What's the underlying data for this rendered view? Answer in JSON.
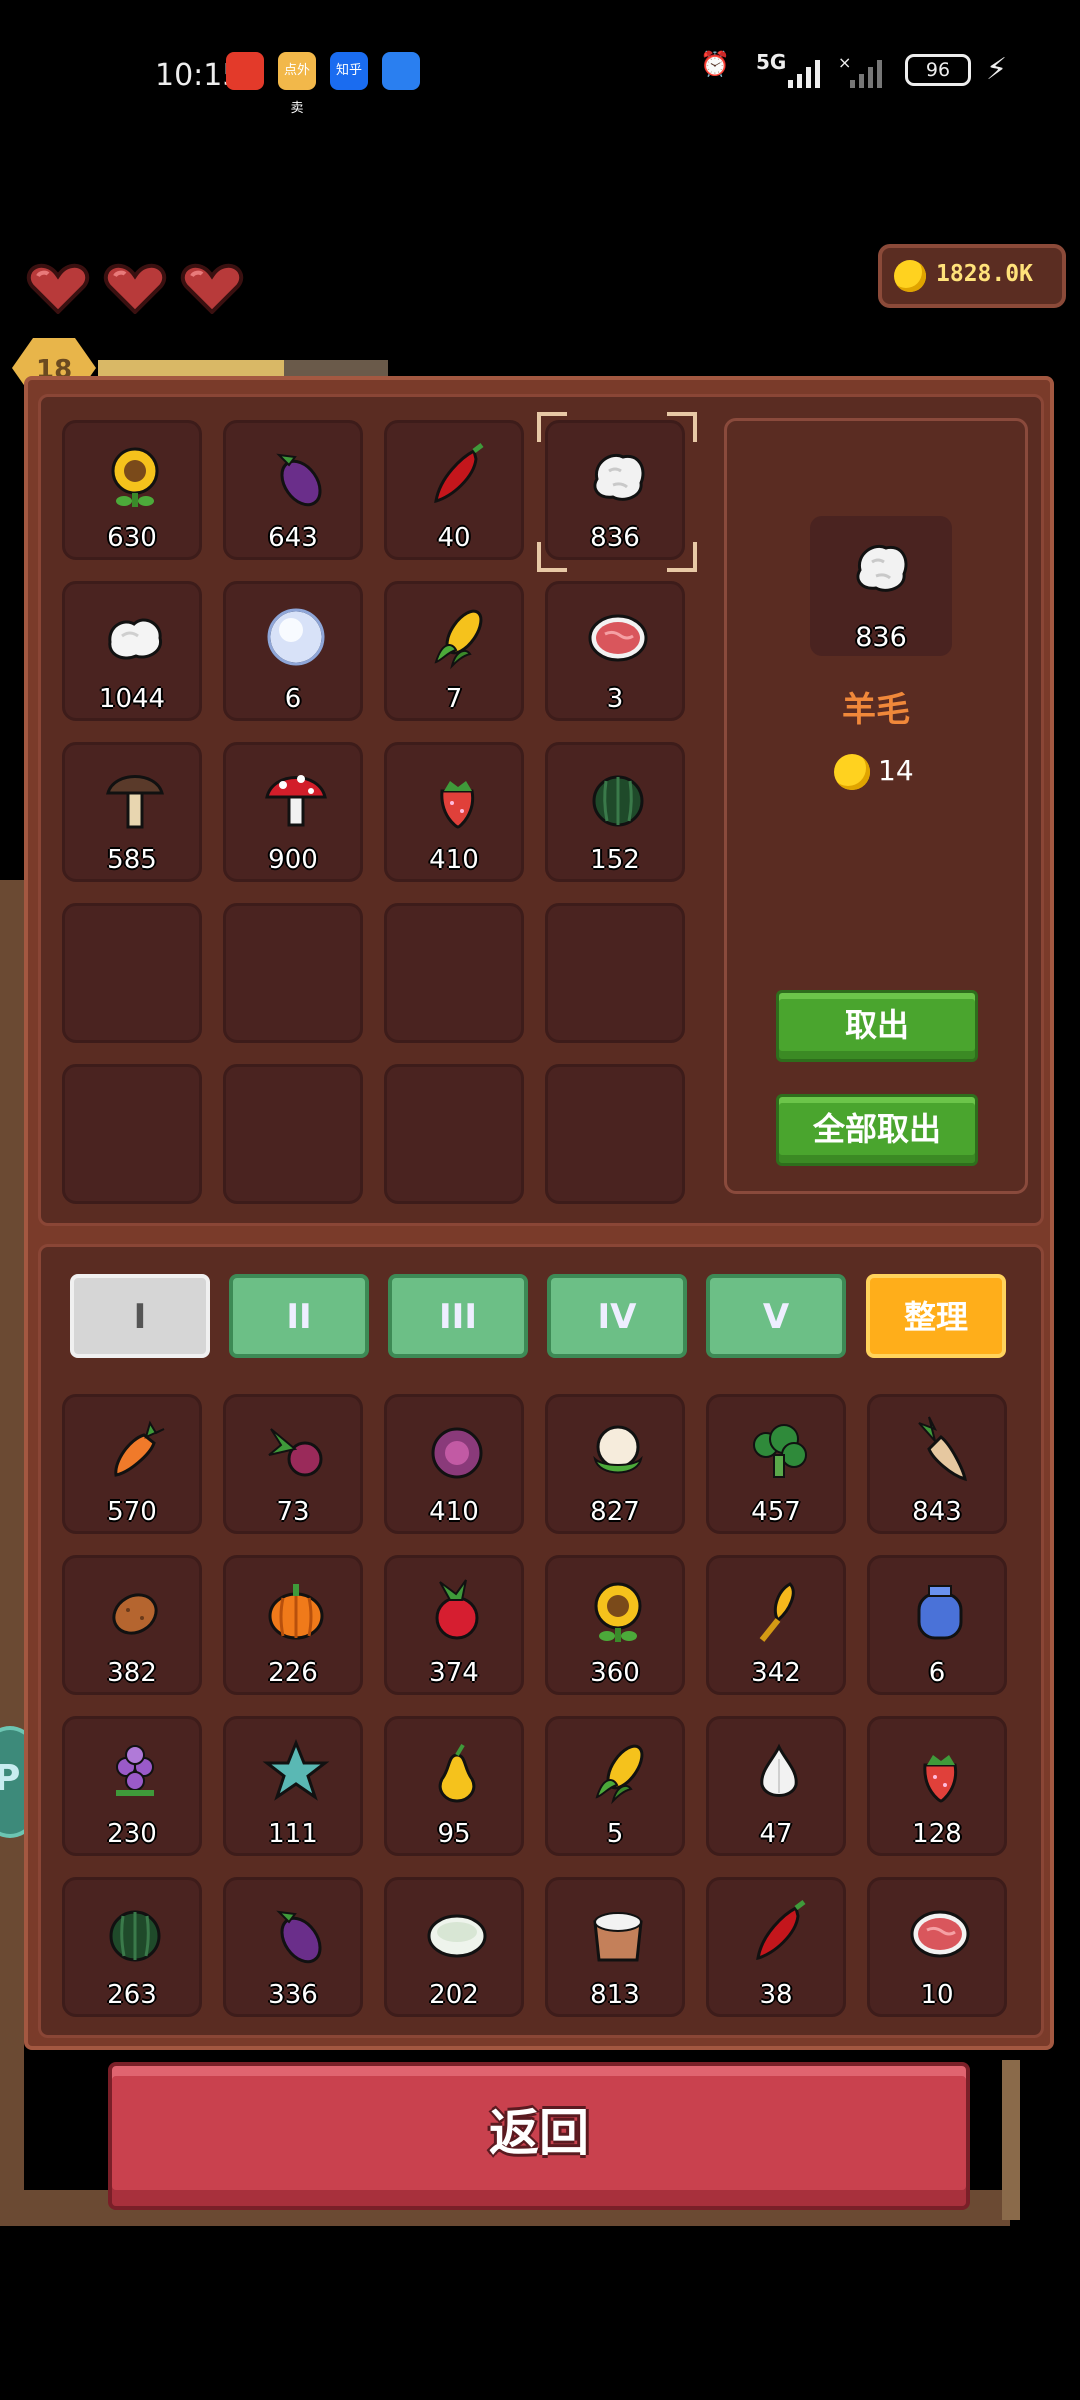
{
  "status_bar": {
    "time": "10:15",
    "apps": [
      {
        "name": "app1",
        "color": "#e33a2a",
        "label": ""
      },
      {
        "name": "app2",
        "color": "#f2b84a",
        "label": "点外卖"
      },
      {
        "name": "app3",
        "color": "#1a6cf0",
        "label": "知乎"
      },
      {
        "name": "app4",
        "color": "#2a7ff0",
        "label": ""
      }
    ],
    "network": "5G",
    "battery": "96"
  },
  "hud": {
    "hearts": 3,
    "coins": "1828.0K",
    "level": "18",
    "xp_fraction": 0.64
  },
  "storage": {
    "items": [
      {
        "icon": "sunflower",
        "count": "630"
      },
      {
        "icon": "eggplant",
        "count": "643"
      },
      {
        "icon": "chili",
        "count": "40"
      },
      {
        "icon": "wool",
        "count": "836",
        "selected": true
      },
      {
        "icon": "cotton",
        "count": "1044"
      },
      {
        "icon": "pearl",
        "count": "6"
      },
      {
        "icon": "corn",
        "count": "7"
      },
      {
        "icon": "meat",
        "count": "3"
      },
      {
        "icon": "brown-mushroom",
        "count": "585"
      },
      {
        "icon": "red-mushroom",
        "count": "900"
      },
      {
        "icon": "strawberry",
        "count": "410"
      },
      {
        "icon": "watermelon",
        "count": "152"
      },
      {
        "icon": "",
        "count": ""
      },
      {
        "icon": "",
        "count": ""
      },
      {
        "icon": "",
        "count": ""
      },
      {
        "icon": "",
        "count": ""
      },
      {
        "icon": "",
        "count": ""
      },
      {
        "icon": "",
        "count": ""
      },
      {
        "icon": "",
        "count": ""
      },
      {
        "icon": "",
        "count": ""
      }
    ]
  },
  "detail": {
    "icon": "wool",
    "count": "836",
    "name": "羊毛",
    "price": "14",
    "take_label": "取出",
    "take_all_label": "全部取出"
  },
  "bag": {
    "tabs": [
      "I",
      "II",
      "III",
      "IV",
      "V"
    ],
    "active_tab": 0,
    "sort_label": "整理",
    "items": [
      {
        "icon": "carrot",
        "count": "570"
      },
      {
        "icon": "beet",
        "count": "73"
      },
      {
        "icon": "cabbage-purple",
        "count": "410"
      },
      {
        "icon": "cauliflower",
        "count": "827"
      },
      {
        "icon": "broccoli",
        "count": "457"
      },
      {
        "icon": "parsnip",
        "count": "843"
      },
      {
        "icon": "potato",
        "count": "382"
      },
      {
        "icon": "pumpkin",
        "count": "226"
      },
      {
        "icon": "radish",
        "count": "374"
      },
      {
        "icon": "sunflower",
        "count": "360"
      },
      {
        "icon": "wheat",
        "count": "342"
      },
      {
        "icon": "blue-jar",
        "count": "6"
      },
      {
        "icon": "grape",
        "count": "230"
      },
      {
        "icon": "starfruit",
        "count": "111"
      },
      {
        "icon": "pear",
        "count": "95"
      },
      {
        "icon": "corn",
        "count": "5"
      },
      {
        "icon": "garlic",
        "count": "47"
      },
      {
        "icon": "strawberry",
        "count": "128"
      },
      {
        "icon": "watermelon",
        "count": "263"
      },
      {
        "icon": "eggplant",
        "count": "336"
      },
      {
        "icon": "rice",
        "count": "202"
      },
      {
        "icon": "flour-sack",
        "count": "813"
      },
      {
        "icon": "chili",
        "count": "38"
      },
      {
        "icon": "meat",
        "count": "10"
      }
    ]
  },
  "back_label": "返回",
  "colors": {
    "frame": "#7a3b2a",
    "slot": "#4a2320",
    "green": "#4aa52e",
    "orange": "#ffae1a",
    "red": "#c9414e",
    "name": "#f0883a"
  }
}
